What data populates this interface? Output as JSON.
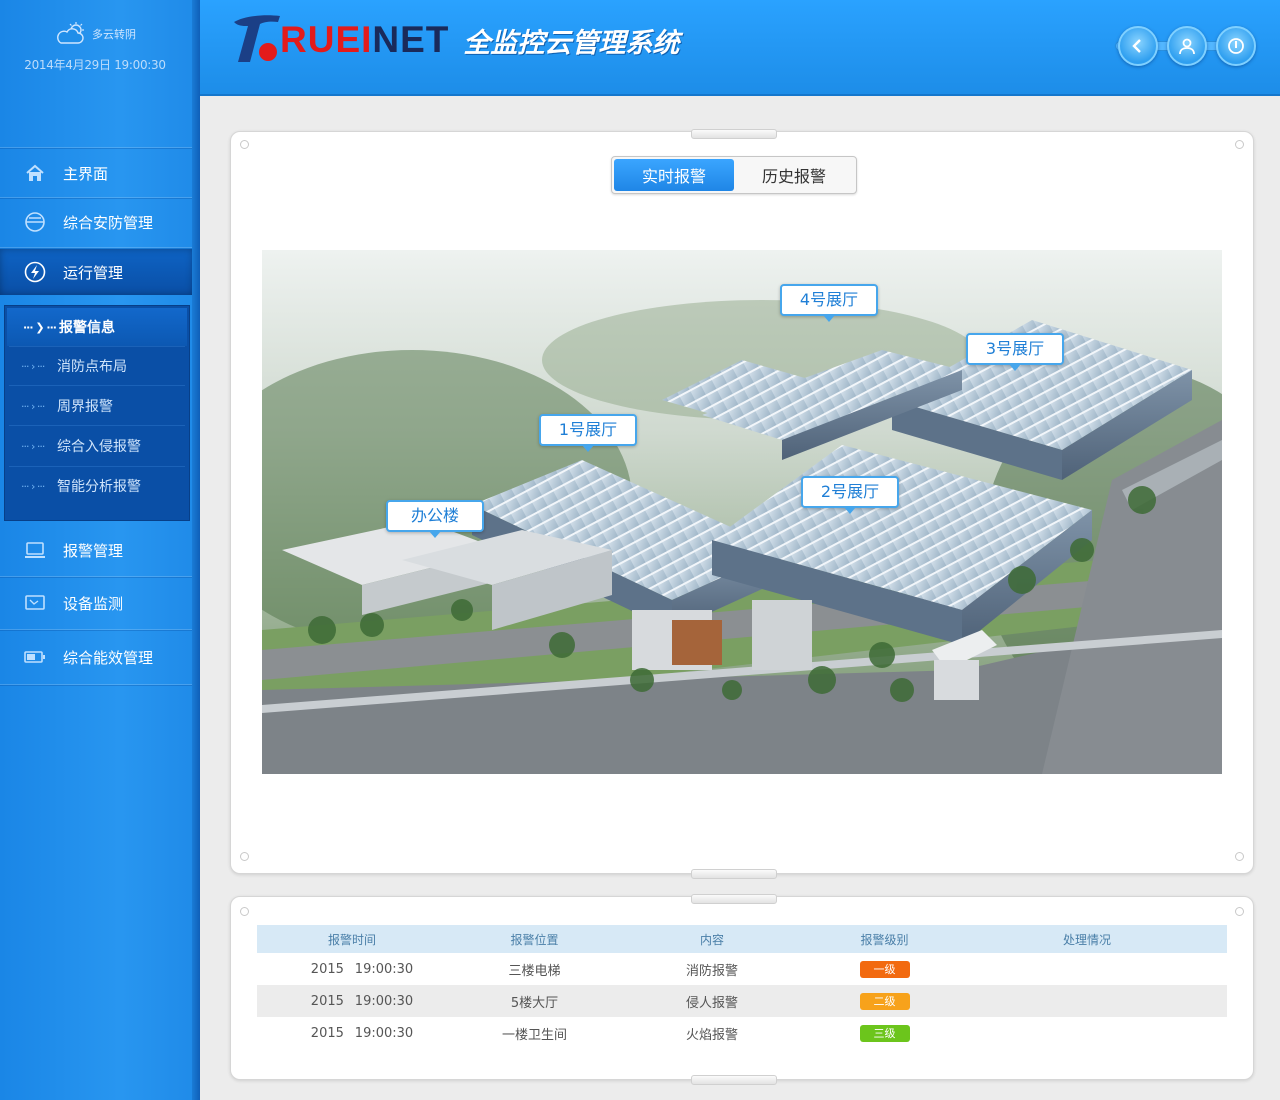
{
  "sidebar": {
    "weather_text": "多云转阴",
    "datetime": "2014年4月29日 19:00:30",
    "nav": [
      {
        "label": "主界面",
        "icon": "home-icon"
      },
      {
        "label": "综合安防管理",
        "icon": "helmet-icon"
      },
      {
        "label": "运行管理",
        "icon": "lightning-icon"
      },
      {
        "label": "报警管理",
        "icon": "laptop-icon"
      },
      {
        "label": "设备监测",
        "icon": "monitor-icon"
      },
      {
        "label": "综合能效管理",
        "icon": "battery-icon"
      }
    ],
    "submenu": [
      {
        "label": "报警信息"
      },
      {
        "label": "消防点布局"
      },
      {
        "label": "周界报警"
      },
      {
        "label": "综合入侵报警"
      },
      {
        "label": "智能分析报警"
      }
    ]
  },
  "header": {
    "brand_red": "RUEI",
    "brand_dark": "NET",
    "system_title": "全监控云管理系统",
    "buttons": [
      "back-icon",
      "user-icon",
      "power-icon"
    ]
  },
  "tabs": {
    "realtime": "实时报警",
    "history": "历史报警"
  },
  "map": {
    "labels": {
      "hall4": "4号展厅",
      "hall3": "3号展厅",
      "hall1": "1号展厅",
      "hall2": "2号展厅",
      "office": "办公楼"
    }
  },
  "alarm_table": {
    "headers": [
      "报警时间",
      "报警位置",
      "内容",
      "报警级别",
      "处理情况"
    ],
    "rows": [
      {
        "year": "2015",
        "time": "19:00:30",
        "location": "三楼电梯",
        "content": "消防报警",
        "level": "一级",
        "level_color": "#f26a10",
        "status": ""
      },
      {
        "year": "2015",
        "time": "19:00:30",
        "location": "5楼大厅",
        "content": "侵人报警",
        "level": "二级",
        "level_color": "#f7a21b",
        "status": ""
      },
      {
        "year": "2015",
        "time": "19:00:30",
        "location": "一楼卫生间",
        "content": "火焰报警",
        "level": "三级",
        "level_color": "#6cc51c",
        "status": ""
      }
    ]
  },
  "colors": {
    "accent": "#2896f0",
    "brand_red": "#e31b1b"
  }
}
